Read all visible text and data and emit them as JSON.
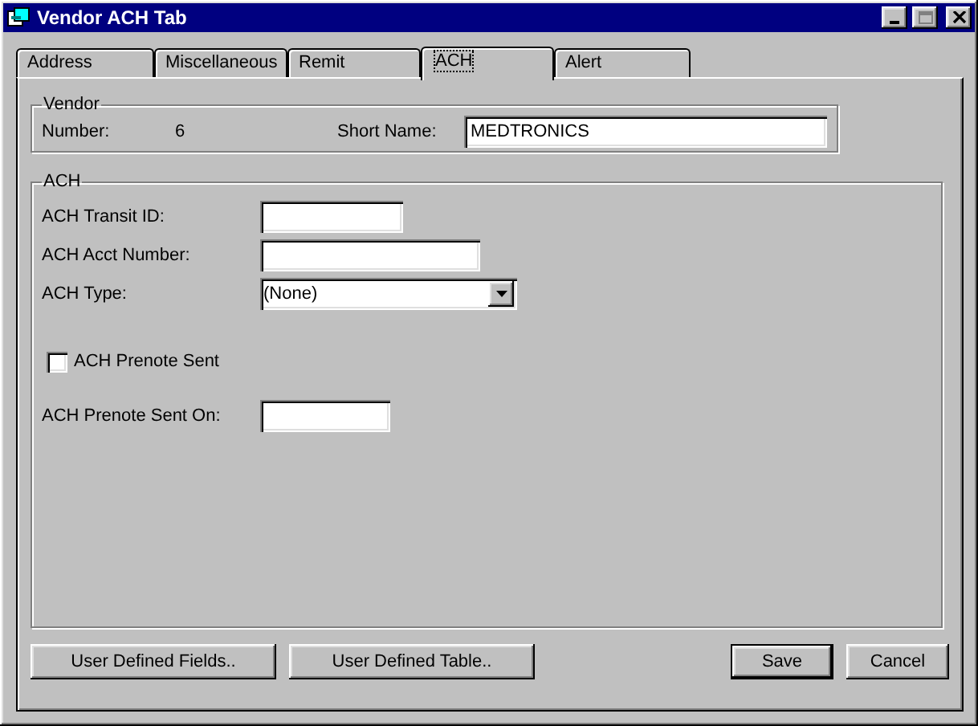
{
  "window": {
    "title": "Vendor ACH Tab"
  },
  "tabs": [
    {
      "label": "Address",
      "selected": false
    },
    {
      "label": "Miscellaneous",
      "selected": false
    },
    {
      "label": "Remit",
      "selected": false
    },
    {
      "label": "ACH",
      "selected": true
    },
    {
      "label": "Alert",
      "selected": false
    }
  ],
  "vendor": {
    "legend": "Vendor",
    "number_label": "Number:",
    "number": "6",
    "short_name_label": "Short Name:",
    "short_name": "MEDTRONICS"
  },
  "ach": {
    "legend": "ACH",
    "fields": [
      {
        "kind": "text",
        "label": "ACH Transit ID:"
      },
      {
        "kind": "text",
        "label": "ACH Acct Number:"
      },
      {
        "kind": "dropdown",
        "label": "ACH Type:",
        "value": "(None)"
      },
      {
        "kind": "checkbox",
        "label": "ACH Prenote Sent",
        "checked": false
      },
      {
        "kind": "text",
        "label": "ACH Prenote Sent On:"
      }
    ]
  },
  "left_buttons": [
    {
      "label": "User Defined Fields..",
      "default": false
    },
    {
      "label": "User Defined Table..",
      "default": false
    }
  ],
  "right_buttons": [
    {
      "label": "Save",
      "default": true
    },
    {
      "label": "Cancel",
      "default": false
    }
  ]
}
